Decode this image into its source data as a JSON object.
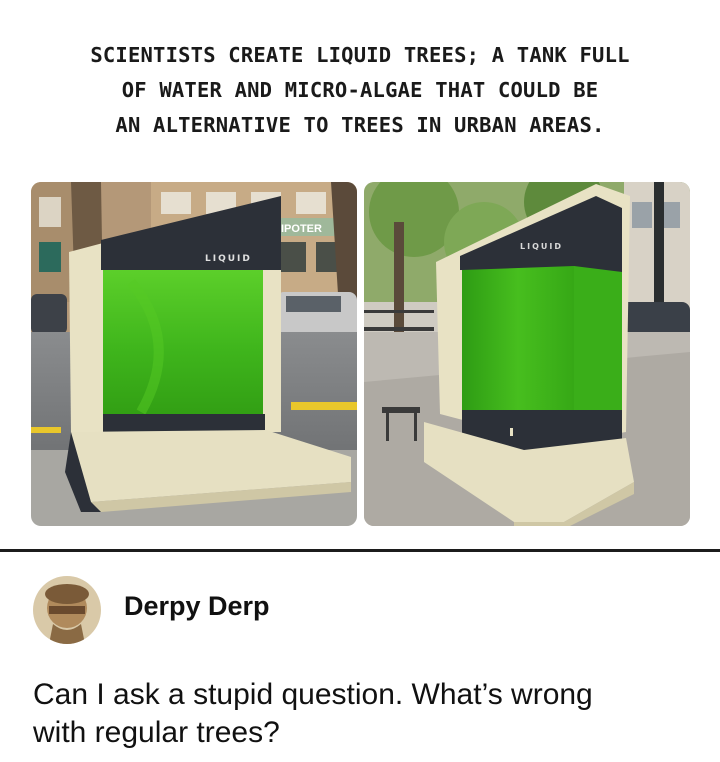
{
  "headline": {
    "lines": [
      "SCIENTISTS CREATE LIQUID TREES; A TANK FULL",
      "OF WATER AND MICRO-ALGAE THAT COULD BE",
      "AN ALTERNATIVE TO TREES IN URBAN AREAS."
    ]
  },
  "photos": {
    "left": {
      "tank_label": "LIQUID",
      "sign_text": "IPOTER"
    },
    "right": {
      "tank_label": "LIQUID"
    }
  },
  "comment": {
    "author": "Derpy Derp",
    "lines": [
      "Can I ask a stupid question. What’s wrong",
      "with regular trees?"
    ]
  },
  "colors": {
    "algae_green": "#3fb51c",
    "tank_housing": "#e8e2c4",
    "panel_dark": "#2c3038"
  }
}
